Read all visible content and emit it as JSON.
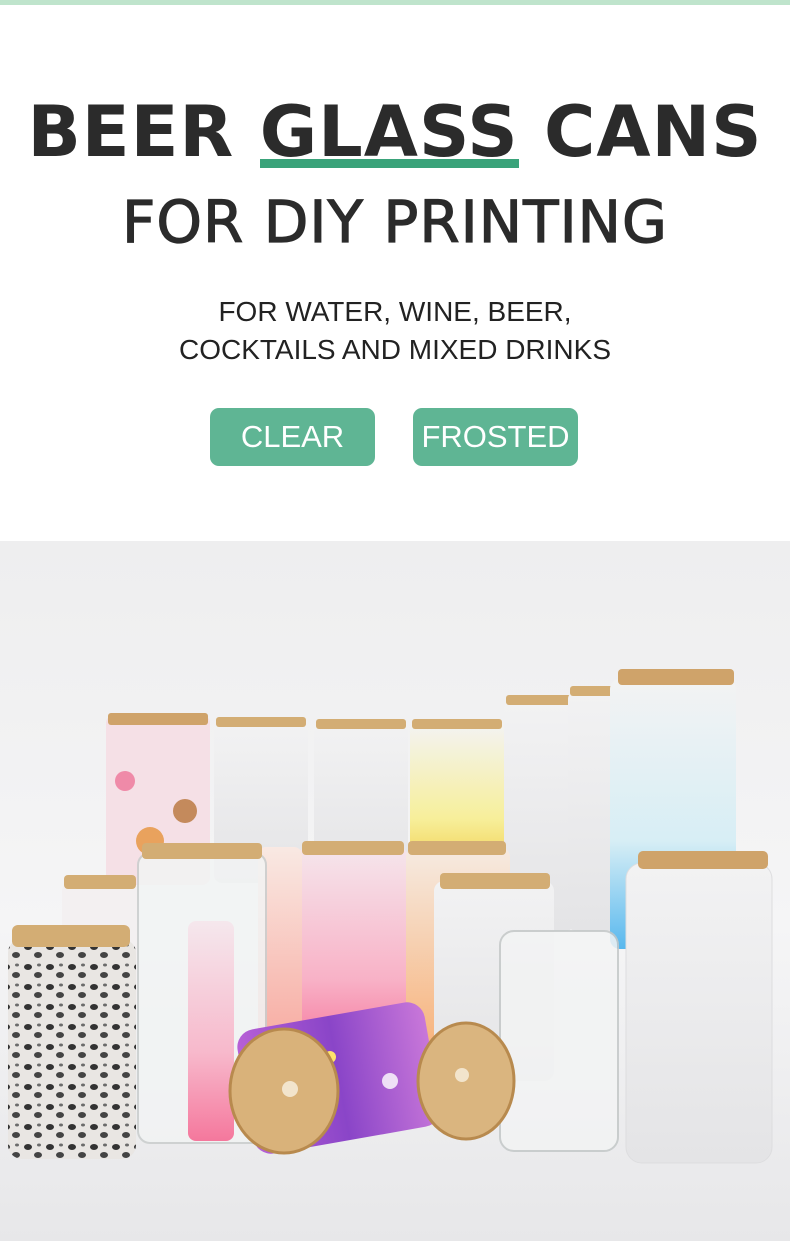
{
  "headline": {
    "line1_before": "BEER ",
    "line1_highlight": "GLASS",
    "line1_after": " CANS",
    "line2": "FOR DIY PRINTING"
  },
  "subtitle": {
    "line1": "FOR WATER, WINE, BEER,",
    "line2": "COCKTAILS AND MIXED DRINKS"
  },
  "options": [
    {
      "label": "CLEAR"
    },
    {
      "label": "FROSTED"
    }
  ],
  "colors": {
    "accent": "#5fb594",
    "highlight_bar": "#3aa37a",
    "top_strip": "#bfe4cc",
    "text": "#2b2b2b"
  }
}
